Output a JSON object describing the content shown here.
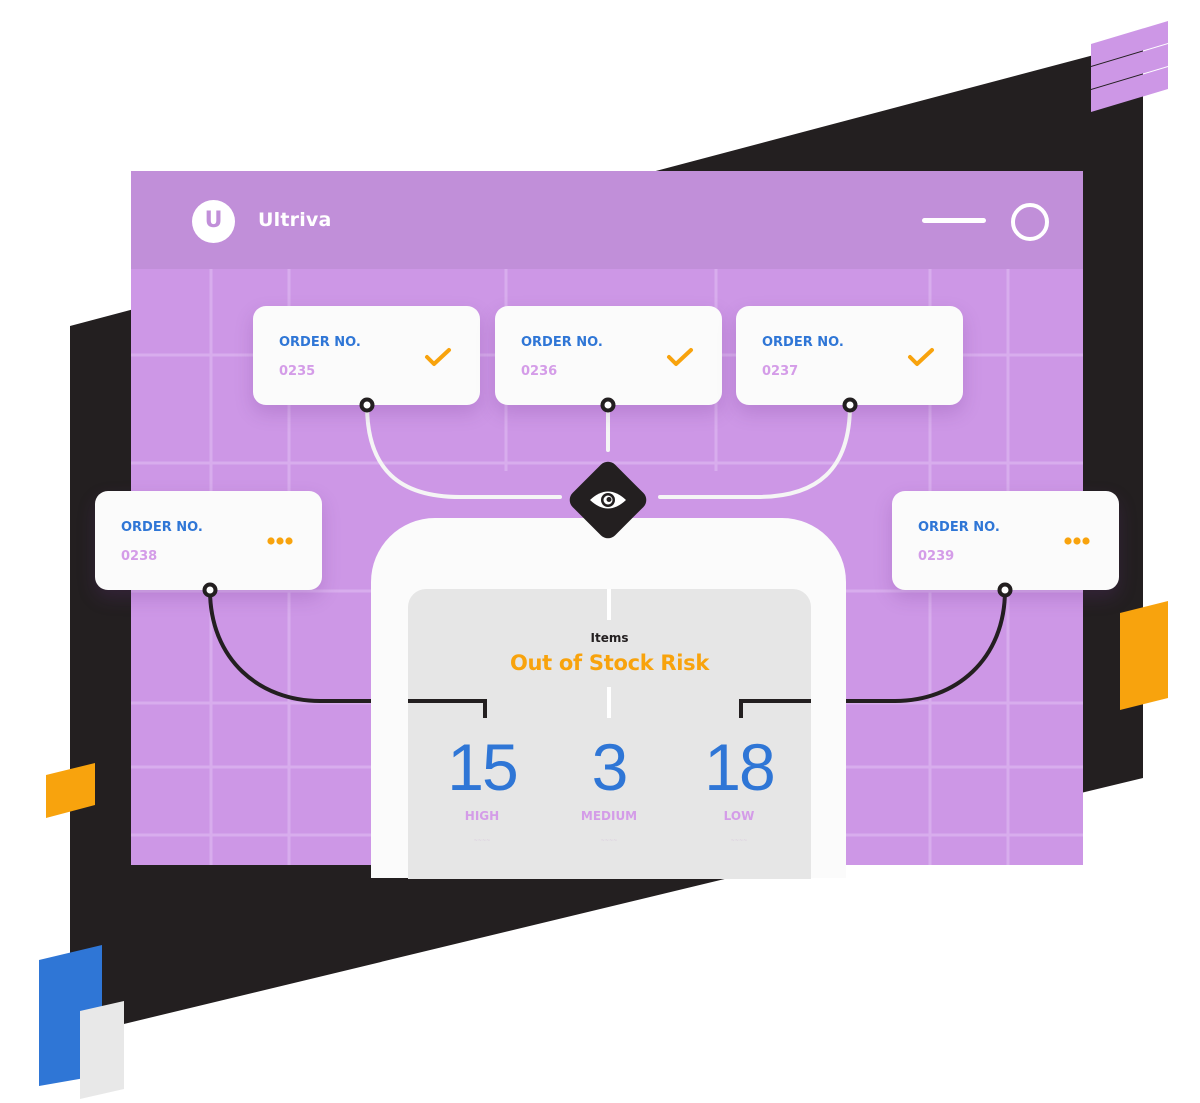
{
  "colors": {
    "window_bg": "#cd97e6",
    "header_bg": "#c18fd9",
    "dark_backdrop": "#231f20",
    "card_bg": "#fbfbfb",
    "blue_accent": "#2f76d6",
    "orange_accent": "#f8a30d",
    "lilac_text": "#d49ce8",
    "screen_bg": "#e6e6e6",
    "light_grey_block": "#e6e6e6"
  },
  "header": {
    "logo_letter": "U",
    "logo_icon": "ultriva-logo-icon",
    "app_title": "Ultriva",
    "minimize_icon": "minimize-icon",
    "maximize_icon": "circle-icon"
  },
  "orders": [
    {
      "label": "ORDER NO.",
      "number": "0235",
      "status_icon": "checkmark-icon",
      "status": "complete"
    },
    {
      "label": "ORDER NO.",
      "number": "0236",
      "status_icon": "checkmark-icon",
      "status": "complete"
    },
    {
      "label": "ORDER NO.",
      "number": "0237",
      "status_icon": "checkmark-icon",
      "status": "complete"
    },
    {
      "label": "ORDER NO.",
      "number": "0238",
      "status_icon": "ellipsis-icon",
      "status": "pending"
    },
    {
      "label": "ORDER NO.",
      "number": "0239",
      "status_icon": "ellipsis-icon",
      "status": "pending"
    }
  ],
  "hub": {
    "icon": "eye-icon"
  },
  "stock_panel": {
    "subtitle": "Items",
    "title": "Out of Stock Risk",
    "metrics": [
      {
        "value": "15",
        "label": "HIGH",
        "sub": "~~~~"
      },
      {
        "value": "3",
        "label": "MEDIUM",
        "sub": "~~~~"
      },
      {
        "value": "18",
        "label": "LOW",
        "sub": "~~~~"
      }
    ]
  }
}
